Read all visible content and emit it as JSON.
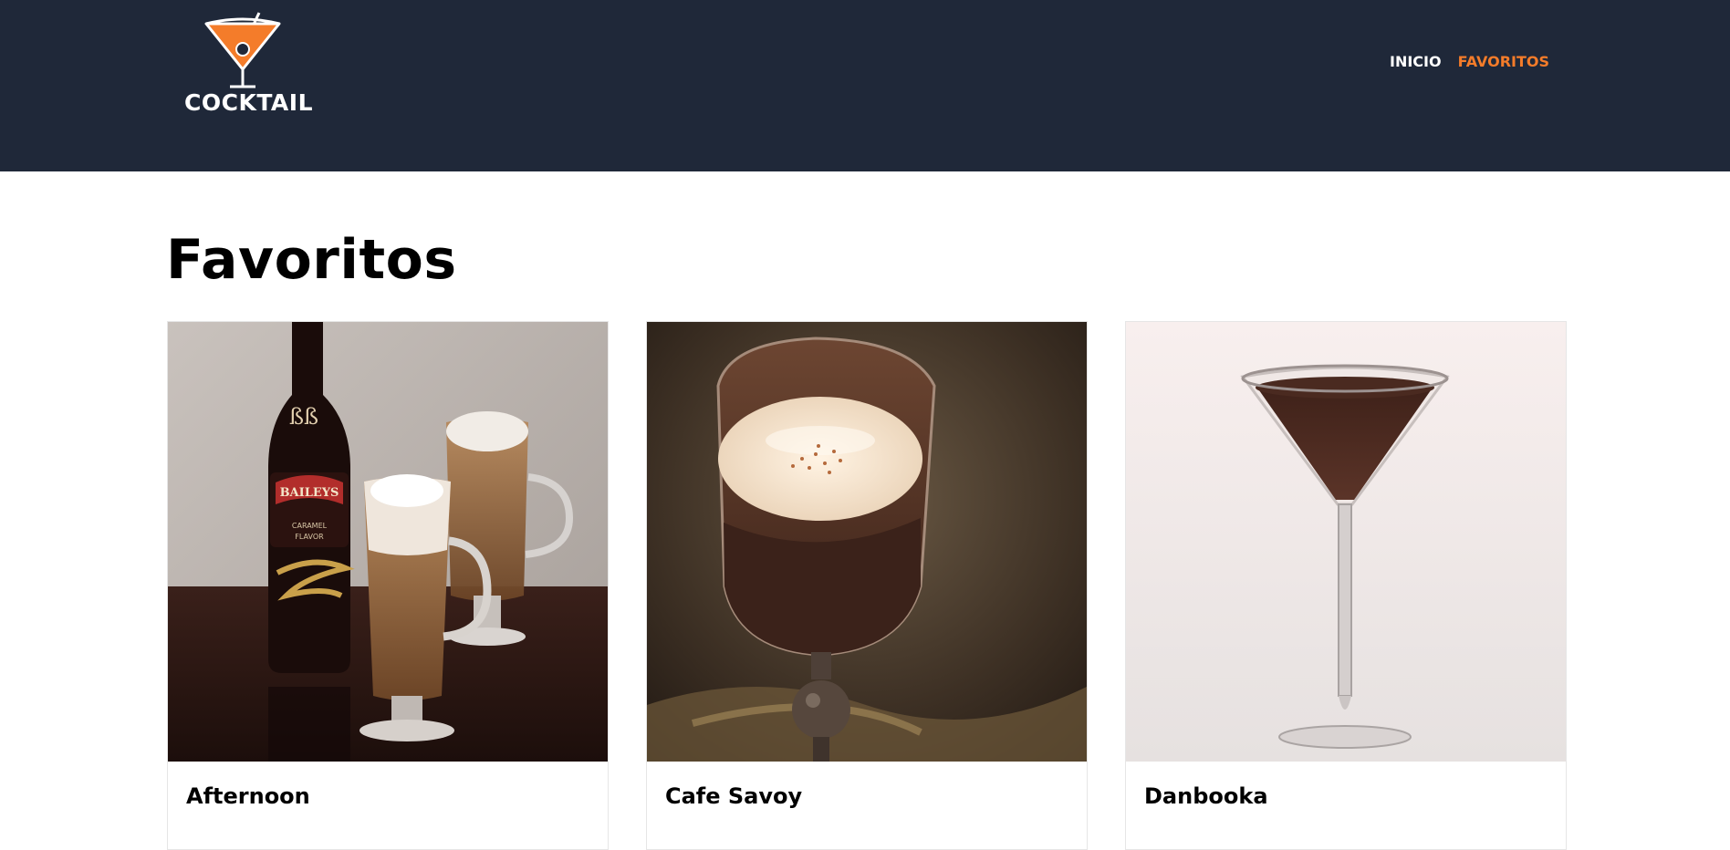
{
  "header": {
    "logo_text": "COCKTAIL",
    "nav": [
      {
        "label": "INICIO"
      },
      {
        "label": "FAVORITOS"
      }
    ],
    "accent_color": "#f47c2a",
    "background_color": "#1f2839"
  },
  "main": {
    "title": "Favoritos",
    "cards": [
      {
        "name": "Afternoon",
        "image": "baileys-coffee-drink"
      },
      {
        "name": "Cafe Savoy",
        "image": "chocolate-coffee-glass"
      },
      {
        "name": "Danbooka",
        "image": "chocolate-martini"
      }
    ]
  }
}
